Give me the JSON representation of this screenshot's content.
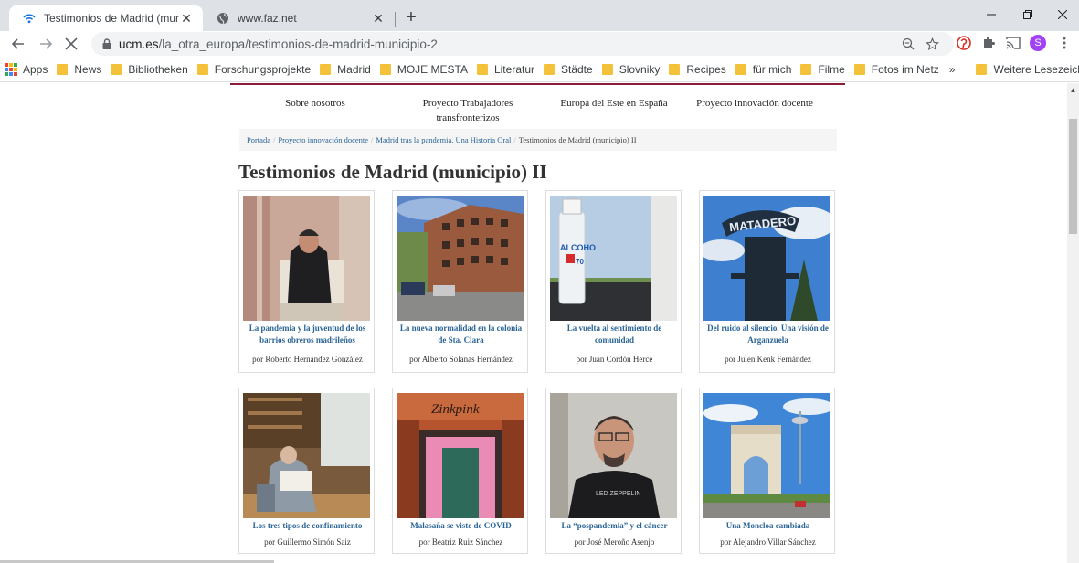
{
  "browser": {
    "tabs": [
      {
        "title": "Testimonios de Madrid (municipio)",
        "active": true
      },
      {
        "title": "www.faz.net",
        "active": false
      }
    ],
    "omnibox": {
      "host": "ucm.es",
      "path": "/la_otra_europa/testimonios-de-madrid-municipio-2"
    },
    "profile_initial": "S",
    "bookmarks": [
      {
        "label": "Apps",
        "icon": "apps-grid-icon"
      },
      {
        "label": "News",
        "icon": "folder-icon"
      },
      {
        "label": "Bibliotheken",
        "icon": "folder-icon"
      },
      {
        "label": "Forschungsprojekte",
        "icon": "folder-icon"
      },
      {
        "label": "Madrid",
        "icon": "folder-icon"
      },
      {
        "label": "MOJE MESTA",
        "icon": "folder-icon"
      },
      {
        "label": "Literatur",
        "icon": "folder-icon"
      },
      {
        "label": "Städte",
        "icon": "folder-icon"
      },
      {
        "label": "Slovniky",
        "icon": "folder-icon"
      },
      {
        "label": "Recipes",
        "icon": "folder-icon"
      },
      {
        "label": "für mich",
        "icon": "folder-icon"
      },
      {
        "label": "Filme",
        "icon": "folder-icon"
      },
      {
        "label": "Fotos im Netz",
        "icon": "folder-icon"
      }
    ],
    "bookmarks_overflow": "»",
    "other_bookmarks": "Weitere Lesezeichen"
  },
  "site": {
    "accent_color": "#8b1d3a",
    "link_color": "#2a6496",
    "nav": [
      {
        "label": "Sobre nosotros"
      },
      {
        "label": "Proyecto Trabajadores transfronterizos"
      },
      {
        "label": "Europa del Este en España"
      },
      {
        "label": "Proyecto innovación docente"
      }
    ],
    "breadcrumb": [
      {
        "label": "Portada",
        "link": true
      },
      {
        "label": "Proyecto innovación docente",
        "link": true
      },
      {
        "label": "Madrid tras la pandemia. Una Historia Oral",
        "link": true
      },
      {
        "label": "Testimonios de Madrid (municipio) II",
        "link": false
      }
    ],
    "breadcrumb_separator": "/",
    "page_title": "Testimonios de Madrid (municipio) II",
    "cards": [
      {
        "title": "La pandemia y la juventud de los barrios obreros madrileños",
        "author": "por Roberto Hernández González"
      },
      {
        "title": "La nueva normalidad en la colonia de Sta. Clara",
        "author": "por Alberto Solanas Hernández"
      },
      {
        "title": "La vuelta al sentimiento de comunidad",
        "author": "por Juan Cordón Herce"
      },
      {
        "title": "Del ruido al silencio. Una visión de Arganzuela",
        "author": "por Julen Kenk Fernández"
      },
      {
        "title": "Los tres tipos de confinamiento",
        "author": "por Guillermo Simón Saiz"
      },
      {
        "title": "Malasaña se viste de COVID",
        "author": "por Beatriz Ruiz Sánchez"
      },
      {
        "title": "La “pospandemia” y el cáncer",
        "author": "por José Meroño Asenjo"
      },
      {
        "title": "Una Moncloa cambiada",
        "author": "por Alejandro Villar Sánchez"
      }
    ]
  }
}
